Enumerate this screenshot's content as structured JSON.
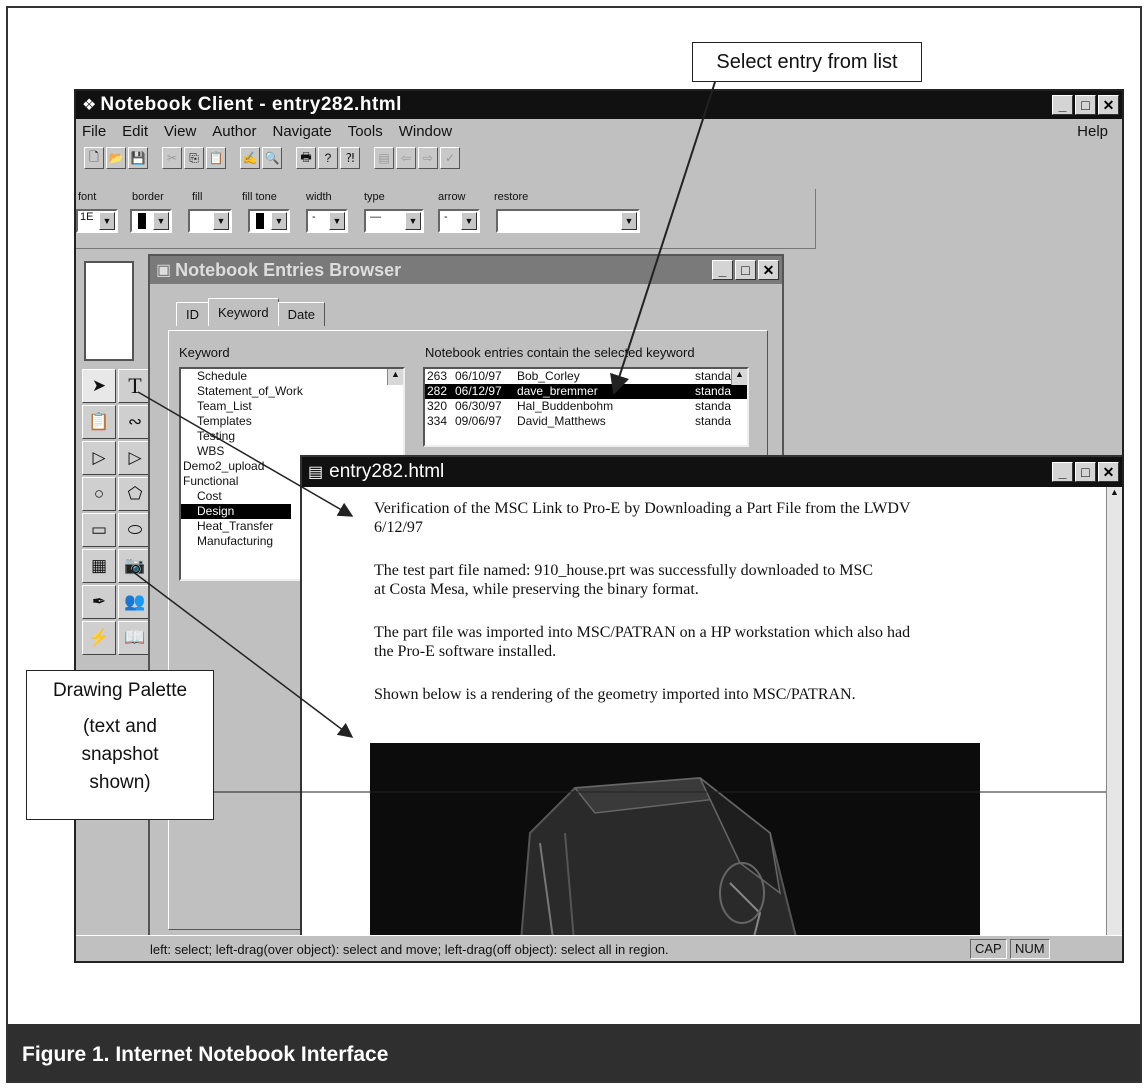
{
  "caption": "Figure 1.  Internet Notebook Interface",
  "callouts": {
    "select_entry": "Select entry from list",
    "palette_title": "Drawing Palette",
    "palette_line1": "(text and",
    "palette_line2": "snapshot",
    "palette_line3": "shown)"
  },
  "main_window": {
    "title": "Notebook Client - entry282.html",
    "menu": [
      "File",
      "Edit",
      "View",
      "Author",
      "Navigate",
      "Tools",
      "Window"
    ],
    "help": "Help",
    "style_labels": [
      "font",
      "border",
      "fill",
      "fill tone",
      "width",
      "type",
      "arrow",
      "restore"
    ],
    "font_value": "1E"
  },
  "browser": {
    "title": "Notebook Entries Browser",
    "tabs": [
      "ID",
      "Keyword",
      "Date"
    ],
    "keyword_label": "Keyword",
    "entries_label": "Notebook entries contain the selected keyword",
    "keywords": [
      "Schedule",
      "Statement_of_Work",
      "Team_List",
      "Templates",
      "Testing",
      "WBS",
      "Demo2_upload",
      "Functional",
      "Cost",
      "Design",
      "Heat_Transfer",
      "Manufacturing"
    ],
    "selected_keyword": "Design",
    "entries": [
      {
        "id": "263",
        "date": "06/10/97",
        "author": "Bob_Corley",
        "type": "standa"
      },
      {
        "id": "282",
        "date": "06/12/97",
        "author": "dave_bremmer",
        "type": "standa"
      },
      {
        "id": "320",
        "date": "06/30/97",
        "author": "Hal_Buddenbohm",
        "type": "standa"
      },
      {
        "id": "334",
        "date": "09/06/97",
        "author": "David_Matthews",
        "type": "standa"
      }
    ],
    "selected_entry": "282"
  },
  "entry_window": {
    "title": "entry282.html",
    "p1": "Verification of the MSC Link to Pro-E by Downloading a Part File from the LWDV",
    "p1_date": "6/12/97",
    "p2a": "The test part file named: 910_house.prt was successfully downloaded to MSC",
    "p2b": "at Costa Mesa, while preserving the binary format.",
    "p3a": "The part file was imported into MSC/PATRAN on a HP workstation which also had",
    "p3b": "the Pro-E software installed.",
    "p4": "Shown below is a rendering of the geometry imported into MSC/PATRAN."
  },
  "statusbar": {
    "text": "left: select; left-drag(over object): select and move; left-drag(off object): select all in region.",
    "cap": "CAP",
    "num": "NUM"
  },
  "colors": {
    "titlebar": "#111111",
    "window_bg": "#c0c0c0",
    "caption_bg": "#2f2f2f"
  }
}
